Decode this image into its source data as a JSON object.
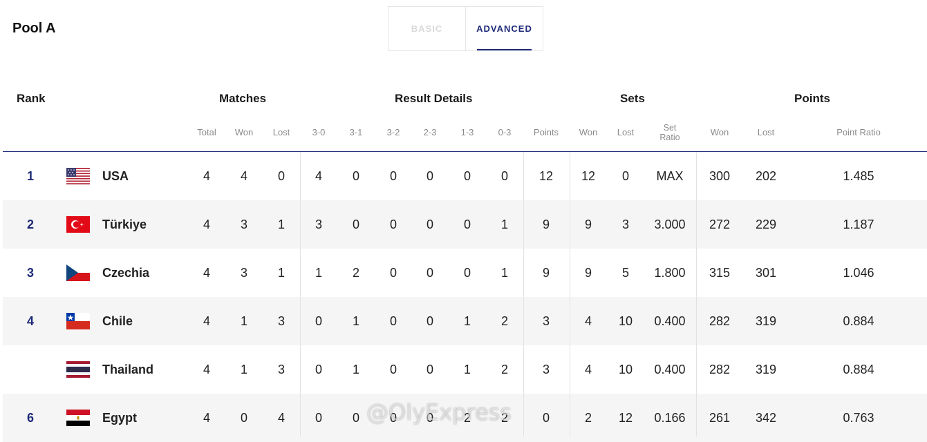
{
  "pool_title": "Pool A",
  "tabs": [
    {
      "label": "BASIC",
      "active": false
    },
    {
      "label": "ADVANCED",
      "active": true
    }
  ],
  "groups": {
    "rank": "Rank",
    "matches": "Matches",
    "result_details": "Result Details",
    "sets": "Sets",
    "points": "Points"
  },
  "subheaders": {
    "m_total": "Total",
    "m_won": "Won",
    "m_lost": "Lost",
    "r30": "3-0",
    "r31": "3-1",
    "r32": "3-2",
    "r23": "2-3",
    "r13": "1-3",
    "r03": "0-3",
    "r_points": "Points",
    "s_won": "Won",
    "s_lost": "Lost",
    "s_ratio_1": "Set",
    "s_ratio_2": "Ratio",
    "p_won": "Won",
    "p_lost": "Lost",
    "p_ratio": "Point Ratio"
  },
  "rows": [
    {
      "rank": "1",
      "team": "USA",
      "flag": "usa-flag",
      "total": "4",
      "won": "4",
      "lost": "0",
      "r30": "4",
      "r31": "0",
      "r32": "0",
      "r23": "0",
      "r13": "0",
      "r03": "0",
      "points": "12",
      "sets_won": "12",
      "sets_lost": "0",
      "set_ratio": "MAX",
      "pts_won": "300",
      "pts_lost": "202",
      "point_ratio": "1.485"
    },
    {
      "rank": "2",
      "team": "Türkiye",
      "flag": "turkiye-flag",
      "total": "4",
      "won": "3",
      "lost": "1",
      "r30": "3",
      "r31": "0",
      "r32": "0",
      "r23": "0",
      "r13": "0",
      "r03": "1",
      "points": "9",
      "sets_won": "9",
      "sets_lost": "3",
      "set_ratio": "3.000",
      "pts_won": "272",
      "pts_lost": "229",
      "point_ratio": "1.187"
    },
    {
      "rank": "3",
      "team": "Czechia",
      "flag": "czechia-flag",
      "total": "4",
      "won": "3",
      "lost": "1",
      "r30": "1",
      "r31": "2",
      "r32": "0",
      "r23": "0",
      "r13": "0",
      "r03": "1",
      "points": "9",
      "sets_won": "9",
      "sets_lost": "5",
      "set_ratio": "1.800",
      "pts_won": "315",
      "pts_lost": "301",
      "point_ratio": "1.046"
    },
    {
      "rank": "4",
      "team": "Chile",
      "flag": "chile-flag",
      "total": "4",
      "won": "1",
      "lost": "3",
      "r30": "0",
      "r31": "1",
      "r32": "0",
      "r23": "0",
      "r13": "1",
      "r03": "2",
      "points": "3",
      "sets_won": "4",
      "sets_lost": "10",
      "set_ratio": "0.400",
      "pts_won": "282",
      "pts_lost": "319",
      "point_ratio": "0.884"
    },
    {
      "rank": "",
      "team": "Thailand",
      "flag": "thailand-flag",
      "total": "4",
      "won": "1",
      "lost": "3",
      "r30": "0",
      "r31": "1",
      "r32": "0",
      "r23": "0",
      "r13": "1",
      "r03": "2",
      "points": "3",
      "sets_won": "4",
      "sets_lost": "10",
      "set_ratio": "0.400",
      "pts_won": "282",
      "pts_lost": "319",
      "point_ratio": "0.884"
    },
    {
      "rank": "6",
      "team": "Egypt",
      "flag": "egypt-flag",
      "total": "4",
      "won": "0",
      "lost": "4",
      "r30": "0",
      "r31": "0",
      "r32": "0",
      "r23": "0",
      "r13": "2",
      "r03": "2",
      "points": "0",
      "sets_won": "2",
      "sets_lost": "12",
      "set_ratio": "0.166",
      "pts_won": "261",
      "pts_lost": "342",
      "point_ratio": "0.763"
    }
  ],
  "watermark": "@OlyExpress",
  "colors": {
    "accent": "#1e2a78",
    "row_alt": "#f5f5f5"
  }
}
